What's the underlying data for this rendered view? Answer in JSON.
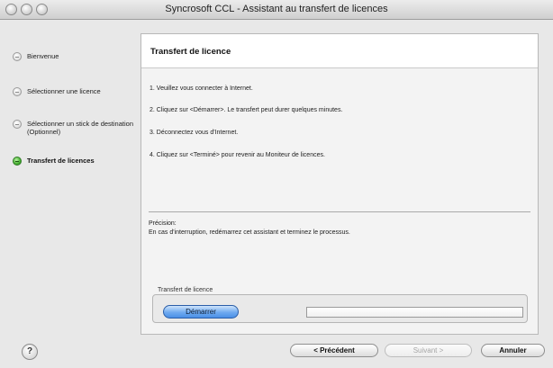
{
  "window": {
    "title": "Syncrosoft CCL - Assistant au transfert de licences"
  },
  "sidebar": {
    "steps": [
      {
        "label": "Bienvenue",
        "active": false
      },
      {
        "label": "Sélectionner une licence",
        "active": false
      },
      {
        "label": "Sélectionner un stick de destination (Optionnel)",
        "active": false
      },
      {
        "label": "Transfert de licences",
        "active": true
      }
    ]
  },
  "panel": {
    "title": "Transfert de licence",
    "instructions": [
      "1.  Veuillez vous connecter à Internet.",
      "2.  Cliquez sur <Démarrer>. Le transfert peut durer quelques minutes.",
      "3.  Déconnectez vous d'Internet.",
      "4.  Cliquez sur <Terminé> pour revenir au Moniteur de licences."
    ],
    "note_heading": "Précision:",
    "note_text": "En cas d'interruption, redémarrez cet assistant et terminez le processus.",
    "transfer_group_label": "Transfert de licence",
    "start_button": "Démarrer",
    "progress": 0
  },
  "footer": {
    "help": "?",
    "previous": "< Précédent",
    "next": "Suivant >",
    "cancel": "Annuler"
  },
  "icons": {
    "window_controls": [
      "close-icon",
      "minimize-icon",
      "zoom-icon"
    ],
    "step_marker": "step-status-icon",
    "help": "help-icon"
  },
  "colors": {
    "active_step": "#45ae2f",
    "primary_button": "#6faaf0"
  }
}
